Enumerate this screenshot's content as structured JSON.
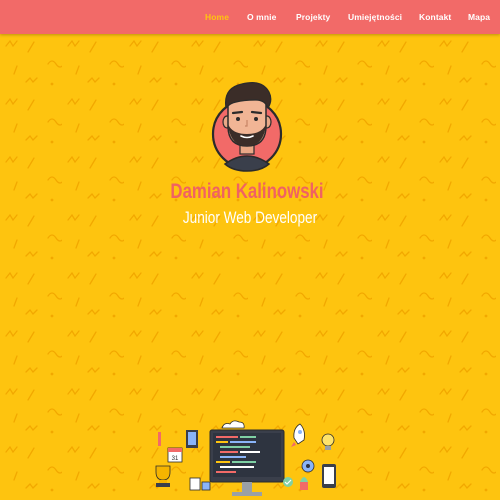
{
  "nav": {
    "items": [
      {
        "label": "Home",
        "active": true
      },
      {
        "label": "O mnie",
        "active": false
      },
      {
        "label": "Projekty",
        "active": false
      },
      {
        "label": "Umiejętności",
        "active": false
      },
      {
        "label": "Kontakt",
        "active": false
      },
      {
        "label": "Mapa",
        "active": false
      }
    ]
  },
  "hero": {
    "name": "Damian Kalinowski",
    "role": "Junior Web Developer",
    "avatar_icon": "developer-avatar-icon",
    "illustration_icon": "web-developer-workspace-illustration"
  },
  "colors": {
    "background": "#fec40f",
    "navbar": "#f26a68",
    "nav_active": "#fec40f",
    "name": "#f06262",
    "role": "#ffffff"
  }
}
